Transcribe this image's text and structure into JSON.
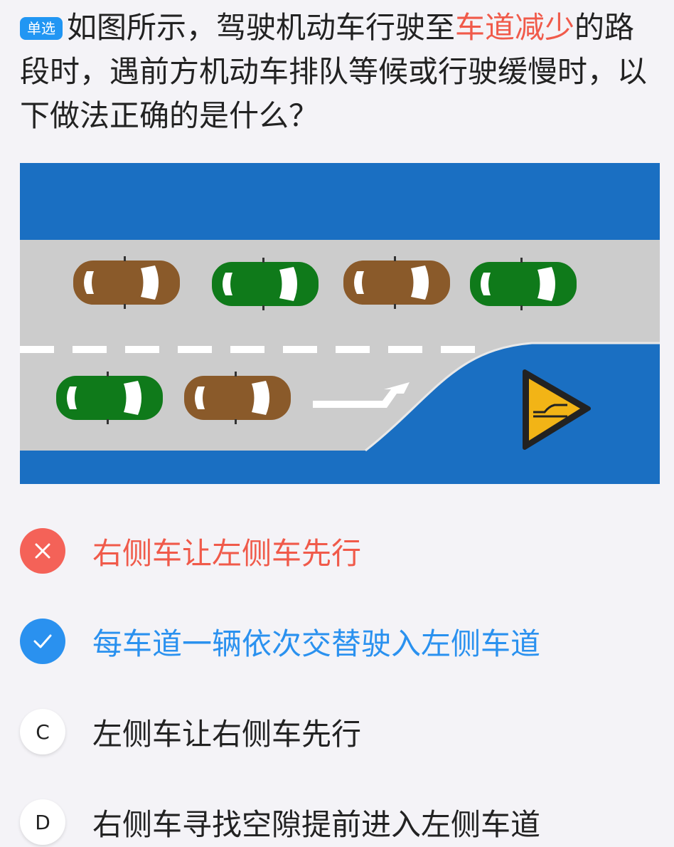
{
  "question": {
    "badge": "单选",
    "text_before": "如图所示，驾驶机动车行驶至",
    "highlight": "车道减少",
    "text_after": "的路段时，遇前方机动车排队等候或行驶缓慢时，以下做法正确的是什么？"
  },
  "options": [
    {
      "marker": "✕",
      "text": "右侧车让左侧车先行",
      "state": "wrong"
    },
    {
      "marker": "✓",
      "text": "每车道一辆依次交替驶入左侧车道",
      "state": "correct"
    },
    {
      "marker": "C",
      "text": "左侧车让右侧车先行",
      "state": "normal"
    },
    {
      "marker": "D",
      "text": "右侧车寻找空隙提前进入左侧车道",
      "state": "normal"
    }
  ],
  "colors": {
    "badge": "#2196f3",
    "wrong": "#f46258",
    "correct": "#2a91ef",
    "road": "#cccccc",
    "shoulder": "#1a6fc2",
    "car_brown": "#8a5a2a",
    "car_green": "#0f7a1a",
    "sign_yellow": "#f2b416"
  },
  "icons": [
    "lane-reduction-sign-icon",
    "merge-arrow-icon",
    "cross-icon",
    "check-icon"
  ]
}
